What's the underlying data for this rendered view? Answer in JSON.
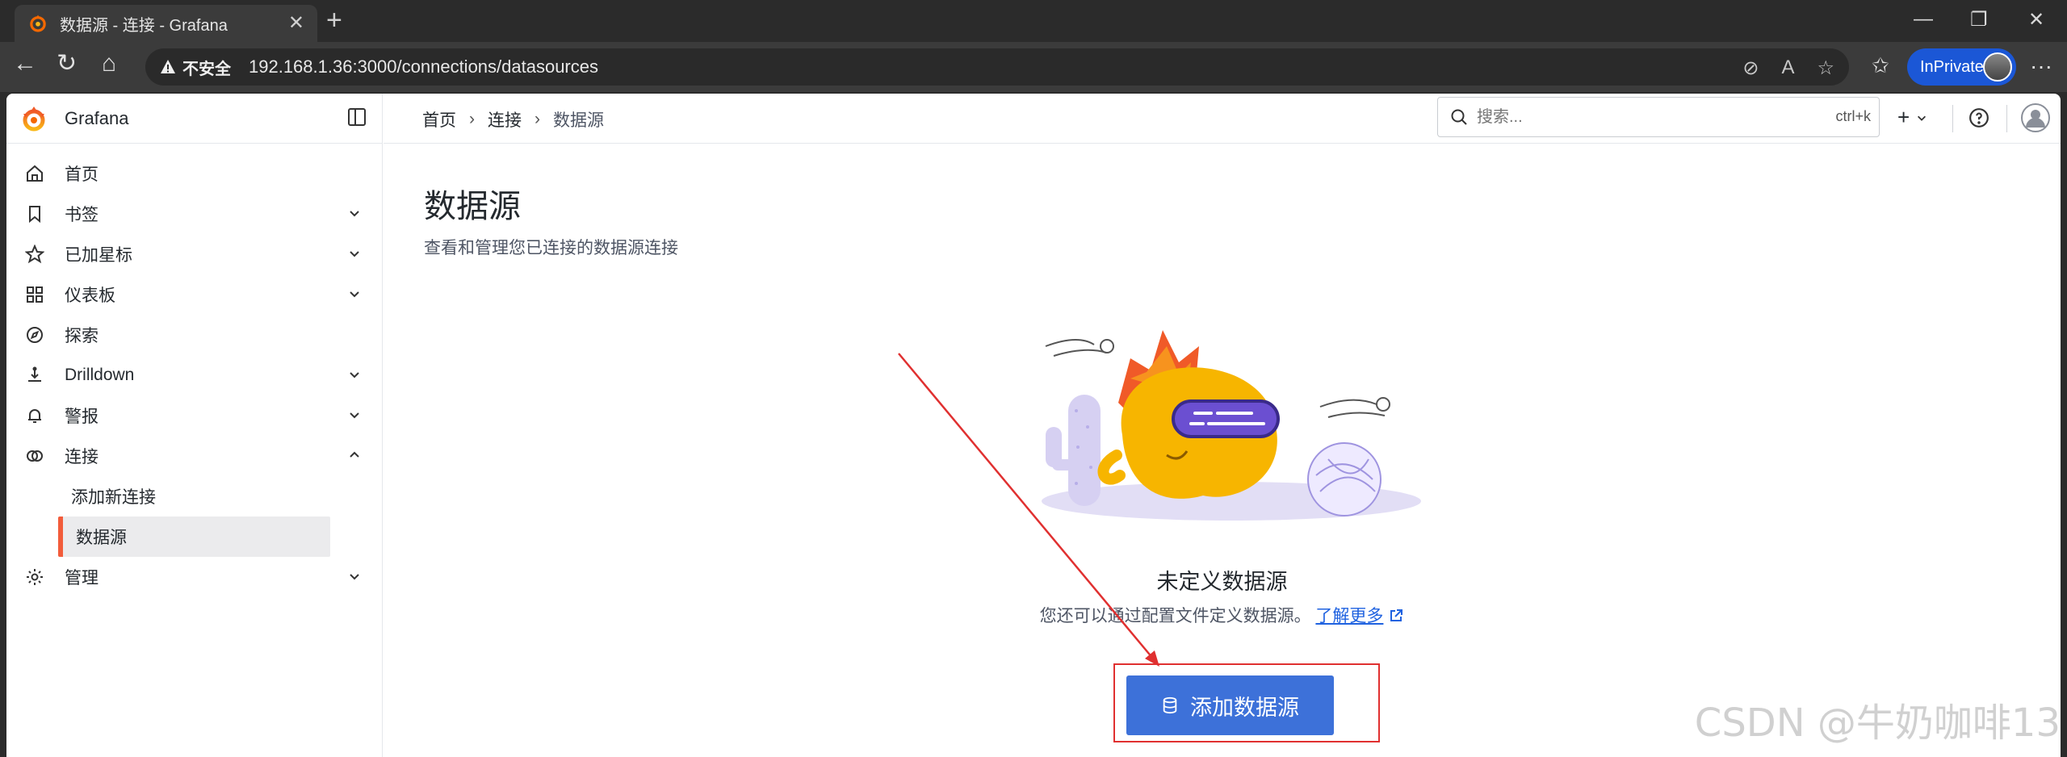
{
  "browser": {
    "tab_title": "数据源 - 连接 - Grafana",
    "security_label": "不安全",
    "url": "192.168.1.36:3000/connections/datasources",
    "inprivate_label": "InPrivate"
  },
  "sidebar": {
    "brand": "Grafana",
    "items": [
      {
        "label": "首页",
        "icon": "home-icon",
        "expandable": false
      },
      {
        "label": "书签",
        "icon": "bookmark-icon",
        "expandable": true
      },
      {
        "label": "已加星标",
        "icon": "star-icon",
        "expandable": true
      },
      {
        "label": "仪表板",
        "icon": "dashboards-icon",
        "expandable": true
      },
      {
        "label": "探索",
        "icon": "compass-icon",
        "expandable": false
      },
      {
        "label": "Drilldown",
        "icon": "drilldown-icon",
        "expandable": true
      },
      {
        "label": "警报",
        "icon": "bell-icon",
        "expandable": true
      },
      {
        "label": "连接",
        "icon": "connections-icon",
        "expandable": true,
        "expanded": true
      },
      {
        "label": "管理",
        "icon": "gear-icon",
        "expandable": true
      }
    ],
    "sub_items": [
      {
        "label": "添加新连接",
        "active": false
      },
      {
        "label": "数据源",
        "active": true
      }
    ]
  },
  "topbar": {
    "breadcrumbs": [
      "首页",
      "连接",
      "数据源"
    ],
    "search_placeholder": "搜索...",
    "search_shortcut": "ctrl+k",
    "add_label": "+"
  },
  "main": {
    "title": "数据源",
    "subtitle": "查看和管理您已连接的数据源连接",
    "empty_title": "未定义数据源",
    "empty_desc": "您还可以通过配置文件定义数据源。",
    "learn_more": "了解更多",
    "add_button": "添加数据源"
  },
  "watermark": "CSDN @牛奶咖啡13",
  "colors": {
    "accent": "#3d71d9",
    "active_marker": "#f25c3b",
    "annotation": "#e03030"
  }
}
